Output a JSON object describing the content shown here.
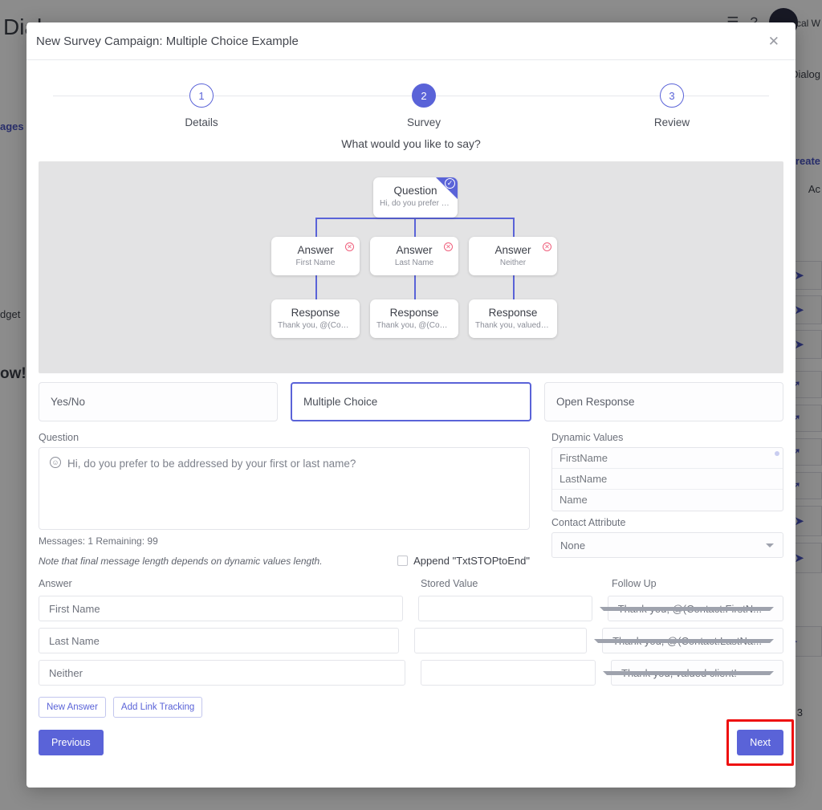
{
  "background": {
    "title": "Dialogs",
    "right_label": "ical W",
    "dialog_label": "Dialog",
    "create_label": "Create",
    "actions_label": "Ac",
    "links": [
      "ages"
    ],
    "texts": [
      "dget"
    ],
    "big_texts": [
      "ow!"
    ],
    "page_number": "3",
    "icons": {
      "notifications": "bell-icon",
      "help": "help-icon",
      "avatar": "avatar"
    }
  },
  "modal": {
    "title": "New Survey Campaign: Multiple Choice Example",
    "close_label": "✕",
    "close_icon": "close-icon"
  },
  "stepper": {
    "steps": [
      {
        "number": "1",
        "label": "Details",
        "active": false
      },
      {
        "number": "2",
        "label": "Survey",
        "active": true
      },
      {
        "number": "3",
        "label": "Review",
        "active": false
      }
    ]
  },
  "prompt": "What would you like to say?",
  "flow": {
    "question_node": {
      "title": "Question",
      "subtitle": "Hi, do you prefer to b...",
      "status_icon": "check-circle-icon",
      "check_glyph": "✓"
    },
    "answer_nodes": [
      {
        "title": "Answer",
        "subtitle": "First Name",
        "delete_icon": "close-circle-icon",
        "delete_glyph": "✕"
      },
      {
        "title": "Answer",
        "subtitle": "Last Name",
        "delete_icon": "close-circle-icon",
        "delete_glyph": "✕"
      },
      {
        "title": "Answer",
        "subtitle": "Neither",
        "delete_icon": "close-circle-icon",
        "delete_glyph": "✕"
      }
    ],
    "response_nodes": [
      {
        "title": "Response",
        "subtitle": "Thank you, @(Contac..."
      },
      {
        "title": "Response",
        "subtitle": "Thank you, @(Contac..."
      },
      {
        "title": "Response",
        "subtitle": "Thank you, valued cli..."
      }
    ]
  },
  "type_options": [
    {
      "label": "Yes/No",
      "selected": false
    },
    {
      "label": "Multiple Choice",
      "selected": true
    },
    {
      "label": "Open Response",
      "selected": false
    }
  ],
  "question": {
    "label": "Question",
    "value": "Hi, do you prefer to be addressed by your first or last name?",
    "emoji_icon": "smiley-icon",
    "emoji_glyph": "☺",
    "message_count": "Messages: 1 Remaining: 99",
    "note": "Note that final message length depends on dynamic values length.",
    "append_label": "Append \"TxtSTOPtoEnd\"",
    "append_checked": false
  },
  "dynamic_values": {
    "label": "Dynamic Values",
    "items": [
      "FirstName",
      "LastName",
      "Name"
    ]
  },
  "contact_attribute": {
    "label": "Contact Attribute",
    "value": "None"
  },
  "answers_table": {
    "headers": {
      "answer": "Answer",
      "stored_value": "Stored Value",
      "follow_up": "Follow Up"
    },
    "rows": [
      {
        "answer": "First Name",
        "stored_value": "",
        "follow_up": "Thank you, @(Contact.FirstN..."
      },
      {
        "answer": "Last Name",
        "stored_value": "",
        "follow_up": "Thank you, @(Contact.LastNa..."
      },
      {
        "answer": "Neither",
        "stored_value": "",
        "follow_up": "Thank you, valued client!"
      }
    ]
  },
  "buttons": {
    "new_answer": "New Answer",
    "add_link_tracking": "Add Link Tracking",
    "previous": "Previous",
    "next": "Next"
  },
  "colors": {
    "accent": "#5a63d8",
    "danger": "#ef5f7c",
    "highlight": "#ee1111",
    "flow_bg": "#e3e3e4"
  }
}
